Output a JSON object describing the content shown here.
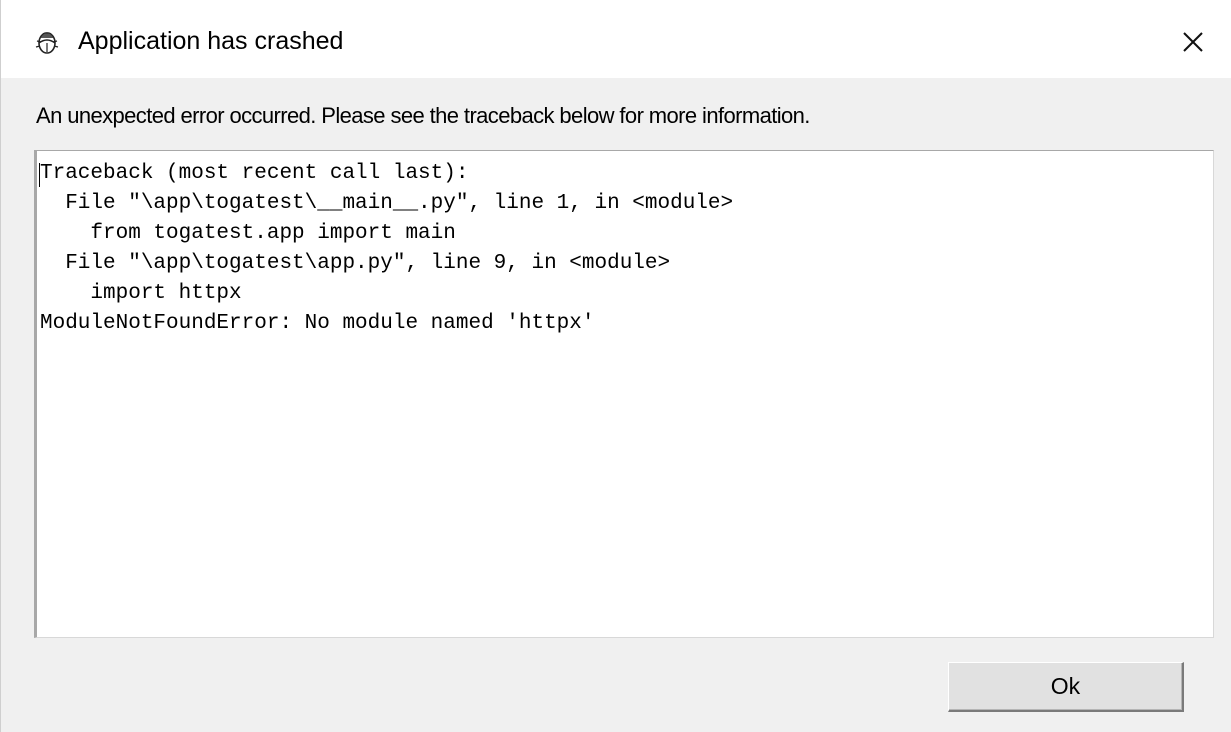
{
  "window": {
    "title": "Application has crashed",
    "icon": "python-bug-icon",
    "close_glyph": "✕"
  },
  "message": "An unexpected error occurred. Please see the traceback below for more information.",
  "traceback": "Traceback (most recent call last):\n  File \"\\app\\togatest\\__main__.py\", line 1, in <module>\n    from togatest.app import main\n  File \"\\app\\togatest\\app.py\", line 9, in <module>\n    import httpx\nModuleNotFoundError: No module named 'httpx'",
  "buttons": {
    "ok_label": "Ok"
  }
}
